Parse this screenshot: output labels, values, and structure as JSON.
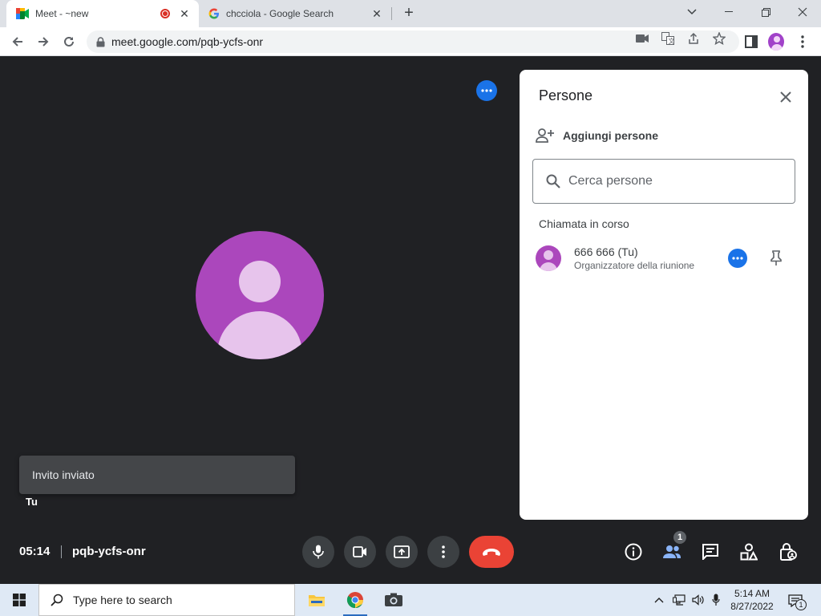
{
  "browser": {
    "tabs": [
      {
        "title": "Meet - ~new",
        "active": true,
        "recording": true
      },
      {
        "title": "chcciola - Google Search",
        "active": false
      }
    ],
    "address": "meet.google.com/pqb-ycfs-onr"
  },
  "meeting": {
    "toast": "Invito inviato",
    "self_label": "Tu",
    "time": "05:14",
    "code": "pqb-ycfs-onr",
    "people_count": "1"
  },
  "panel": {
    "title": "Persone",
    "add_people": "Aggiungi persone",
    "search_placeholder": "Cerca persone",
    "section_title": "Chiamata in corso",
    "participants": [
      {
        "name": "666 666 (Tu)",
        "role": "Organizzatore della riunione"
      }
    ]
  },
  "taskbar": {
    "search_placeholder": "Type here to search",
    "time": "5:14 AM",
    "date": "8/27/2022",
    "notification_count": "1"
  },
  "colors": {
    "meet_blue": "#1a73e8",
    "end_call_red": "#ea4335",
    "avatar_purple": "#ab47bc",
    "stage_bg": "#202124"
  }
}
